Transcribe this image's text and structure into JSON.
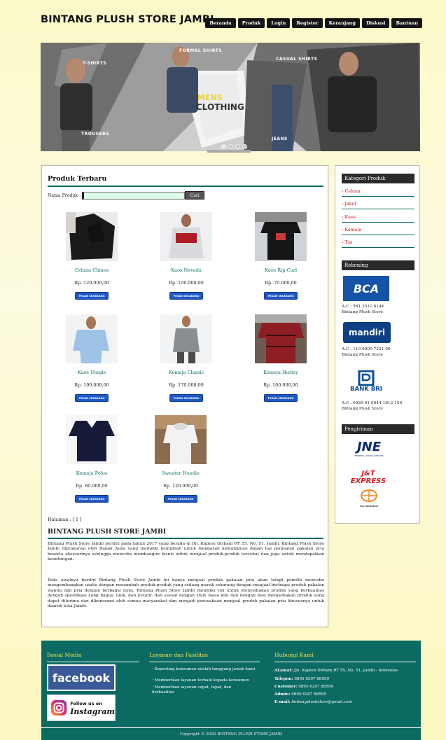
{
  "header": {
    "logo": "BINTANG PLUSH STORE JAMBI",
    "nav": [
      "Beranda",
      "Produk",
      "Login",
      "Register",
      "Keranjang",
      "Diskusi",
      "Bantuan"
    ]
  },
  "banner": {
    "center_title_1": "MENS",
    "center_title_2": "CLOTHING",
    "labels": [
      "T-SHIRTS",
      "FORMAL SHIRTS",
      "CASUAL SHIRTS",
      "TROUSERS",
      "JEANS"
    ]
  },
  "main": {
    "title": "Produk Terbaru",
    "search_label": "Nama Produk :",
    "search_value": "",
    "search_button": "Cari",
    "products": [
      {
        "name": "Celana Chinos",
        "price": "Rp. 120.000,00"
      },
      {
        "name": "Kaos Nevada",
        "price": "Rp. 100.000,00"
      },
      {
        "name": "Kaos Rip Curl",
        "price": "Rp. 70.000,00"
      },
      {
        "name": "Kaos Uniqlo",
        "price": "Rp. 190.000,00"
      },
      {
        "name": "Kemeja Classic",
        "price": "Rp. 170.000,00"
      },
      {
        "name": "Kemeja Hurley",
        "price": "Rp. 100.000,00"
      },
      {
        "name": "Kemeja Polos",
        "price": "Rp. 80.000,00"
      },
      {
        "name": "Sweater Hoodie",
        "price": "Rp. 120.000,00"
      }
    ],
    "buy_label": "PESAN SEKARANG",
    "pagination": "Halaman : [ 1 ]",
    "about_title": "BINTANG PLUSH STORE JAMBI",
    "about_p1": "Bintang Plush Store Jambi berdiri pada tahun 2017 yang berada di Jln. Kapten Dirham RT 55, No. 51, Jambi. Bintang Plush Store Jambi diprakarsai oleh Bapak Aulia yang memiliki keinginan untuk mengasah kemampuan dalam hal penjualan pakaian pria beserta aksesorinya sehingga mencoba membangun bisnis untuk menjual produk-produk tersebut dan juga untuk mendapatkan keuntungan.",
    "about_p2": "Pada awalnya berdiri Bintang Plush Store Jambi ini hanya menjual produk pakaian pria akan tetapi pemilik mencoba mengembangkan usaha dengan menambah produk-produk yang sedang marak sekarang dengan menjual berbagai produk pakaian wanita dan pria dengan berbagai jenis. Bintang Plush Store Jambi memiliki visi untuk menyediakan produk yang berkualitas dengan spesifikasi yang bagus, unik, dan kreatif, dan sesuai dengan style masa kini dan dengan misi menyediakan produk yang dapat diterima dan dikonsumsi oleh semua masyarakat dan menjadi perusahaan menjual produk pakaian pria khususnya untuk daerah kota Jambi."
  },
  "sidebar": {
    "kategori_title": "Kategori Produk",
    "categories": [
      "› Celana",
      "› Jaket",
      "› Kaos",
      "› Kemeja",
      "› Tas"
    ],
    "rekening_title": "Rekening",
    "banks": [
      {
        "logo": "BCA",
        "account": "A.C : 581 3511 6144",
        "holder": "Bintang Plush Store"
      },
      {
        "logo": "mandiri",
        "account": "A.C : 110 0000 7221 00",
        "holder": "Bintang Plush Store"
      },
      {
        "logo": "BANK BRI",
        "account": "A.C : 0020 01 0644 1812 150",
        "holder": "Bintang Plush Store"
      }
    ],
    "pengiriman_title": "Pengiriman",
    "couriers": [
      "JNE",
      "J&T EXPRESS",
      "POS INDONESIA"
    ],
    "jne_tagline": "EXPRESS ACROSS NATIONS"
  },
  "footer": {
    "social_title": "Sosial Media",
    "facebook": "facebook",
    "instagram_1": "Follow us on",
    "instagram_2": "Instagram",
    "layanan_title": "Layanan dan Fasilitas",
    "layanan": [
      "Kepenting konsumen adalah tanggung jawab kami",
      "Memberikan layanan terbaik kepada konsumen",
      "Memberikan layanan cepat, tepat, dan berkualitas"
    ],
    "kontak_title": "Hubungi Kami",
    "kontak": [
      {
        "label": "ALamat:",
        "value": "Jln. Kapten Dirham RT 55, No. 51, Jambi - Indonesia"
      },
      {
        "label": "Telepon:",
        "value": "0895 6207 88599"
      },
      {
        "label": "Customer:",
        "value": "0895 6207 88599"
      },
      {
        "label": "Admin:",
        "value": "0895 6207 88599"
      },
      {
        "label": "E-mail:",
        "value": "bintangplushstore@gmail.com"
      }
    ],
    "copyright": "Copyright © 2020 BINTANG PLUSH STORE JAMBI"
  },
  "colors": {
    "accent": "#0b6b62",
    "button": "#1f58c8",
    "category": "#c81414"
  }
}
